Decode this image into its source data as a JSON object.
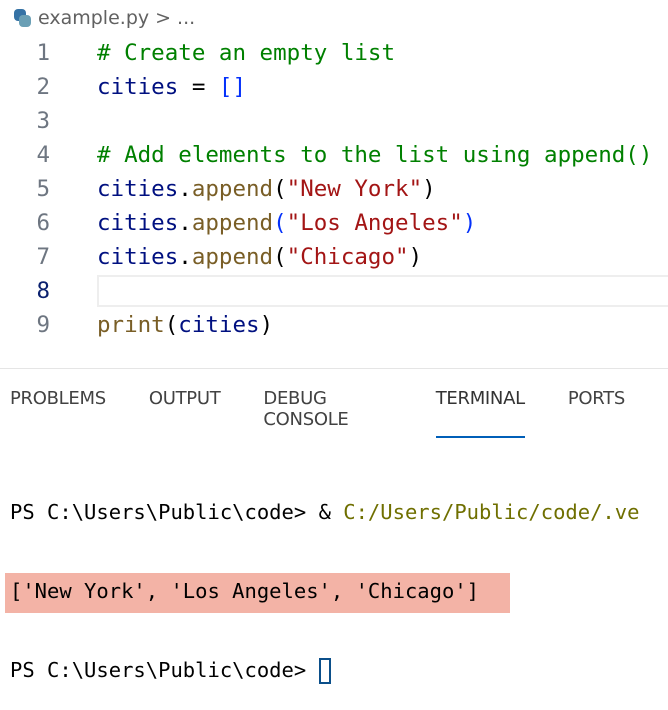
{
  "breadcrumb": {
    "file": "example.py",
    "sep": ">",
    "more": "..."
  },
  "code": [
    {
      "n": "1",
      "tokens": [
        {
          "c": "cm",
          "t": "# Create an empty list"
        }
      ]
    },
    {
      "n": "2",
      "tokens": [
        {
          "c": "vr",
          "t": "cities"
        },
        {
          "c": "tx",
          "t": " = "
        },
        {
          "c": "br",
          "t": "[]"
        }
      ]
    },
    {
      "n": "3",
      "tokens": []
    },
    {
      "n": "4",
      "tokens": [
        {
          "c": "cm",
          "t": "# Add elements to the list using append()"
        }
      ]
    },
    {
      "n": "5",
      "tokens": [
        {
          "c": "vr",
          "t": "cities"
        },
        {
          "c": "tx",
          "t": "."
        },
        {
          "c": "fn",
          "t": "append"
        },
        {
          "c": "tx",
          "t": "("
        },
        {
          "c": "st",
          "t": "\"New York\""
        },
        {
          "c": "tx",
          "t": ")"
        }
      ]
    },
    {
      "n": "6",
      "tokens": [
        {
          "c": "vr",
          "t": "cities"
        },
        {
          "c": "tx",
          "t": "."
        },
        {
          "c": "fn",
          "t": "append"
        },
        {
          "c": "br",
          "t": "("
        },
        {
          "c": "st",
          "t": "\"Los Angeles\""
        },
        {
          "c": "br",
          "t": ")"
        }
      ]
    },
    {
      "n": "7",
      "tokens": [
        {
          "c": "vr",
          "t": "cities"
        },
        {
          "c": "tx",
          "t": "."
        },
        {
          "c": "fn",
          "t": "append"
        },
        {
          "c": "tx",
          "t": "("
        },
        {
          "c": "st",
          "t": "\"Chicago\""
        },
        {
          "c": "tx",
          "t": ")"
        }
      ]
    },
    {
      "n": "8",
      "tokens": [],
      "current": true
    },
    {
      "n": "9",
      "tokens": [
        {
          "c": "fn",
          "t": "print"
        },
        {
          "c": "tx",
          "t": "("
        },
        {
          "c": "vr",
          "t": "cities"
        },
        {
          "c": "tx",
          "t": ")"
        }
      ]
    }
  ],
  "panel": {
    "tabs": [
      "PROBLEMS",
      "OUTPUT",
      "DEBUG CONSOLE",
      "TERMINAL",
      "PORTS"
    ],
    "active": "TERMINAL"
  },
  "terminal": {
    "prompt": "PS C:\\Users\\Public\\code> ",
    "command_amp": "& ",
    "command_path": "C:/Users/Public/code/.ve",
    "output": "['New York', 'Los Angeles', 'Chicago']",
    "prompt2": "PS C:\\Users\\Public\\code> "
  }
}
